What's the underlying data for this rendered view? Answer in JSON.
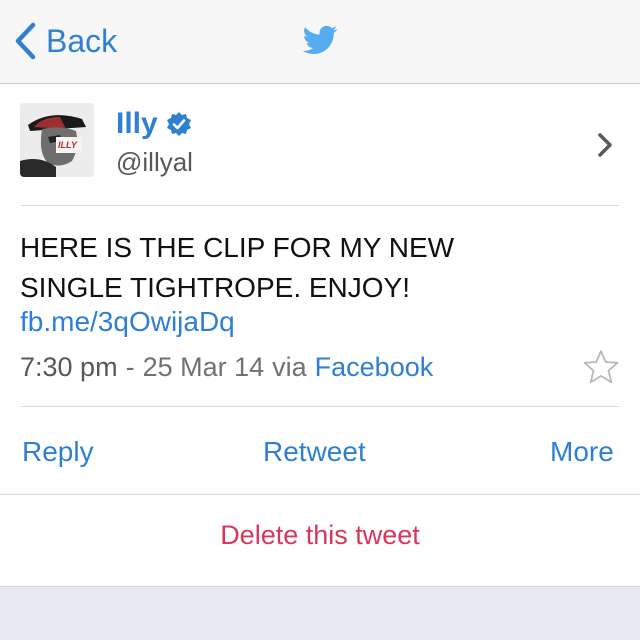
{
  "navbar": {
    "back_label": "Back",
    "logo_icon": "twitter-bird-icon",
    "accent": "#2f7fd3"
  },
  "tweet": {
    "author_name": "Illy",
    "verified_icon": "verified-badge-icon",
    "handle": "@illyal",
    "avatar_logo_text": "ILLY",
    "text_line1": "HERE IS THE CLIP FOR MY NEW",
    "text_line2": "SINGLE TIGHTROPE. ENJOY!",
    "link": "fb.me/3qOwijaDq",
    "time": "7:30 pm",
    "separator": "-",
    "date": "25 Mar 14",
    "via_label": "via",
    "via_source": "Facebook",
    "star_icon": "star-outline-icon"
  },
  "actions": {
    "reply": "Reply",
    "retweet": "Retweet",
    "more": "More"
  },
  "delete_label": "Delete this tweet",
  "colors": {
    "link": "#2f7fd3",
    "delete": "#d9365a",
    "meta": "#6e7276"
  }
}
